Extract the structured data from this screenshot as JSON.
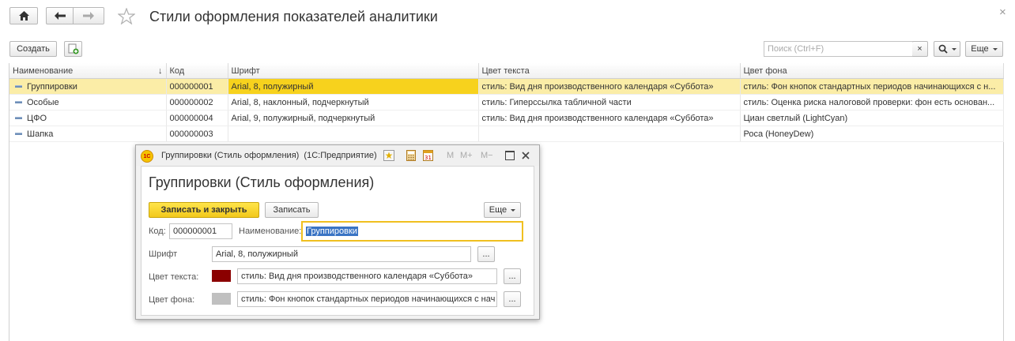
{
  "header": {
    "title": "Стили оформления показателей аналитики",
    "home_icon": "home-icon",
    "back_icon": "arrow-left-icon",
    "forward_icon": "arrow-right-icon",
    "star_icon": "star-icon",
    "close": "×"
  },
  "toolbar": {
    "create_label": "Создать",
    "search_placeholder": "Поиск (Ctrl+F)",
    "search_clear": "×",
    "more_label": "Еще"
  },
  "table": {
    "columns": [
      "Наименование",
      "Код",
      "Шрифт",
      "Цвет текста",
      "Цвет фона"
    ],
    "sort_indicator": "↓",
    "rows": [
      {
        "name": "Группировки",
        "code": "000000001",
        "font": "Arial, 8, полужирный",
        "text_color": "стиль: Вид дня производственного календаря «Суббота»",
        "bg_color": "стиль: Фон кнопок стандартных периодов начинающихся с н..."
      },
      {
        "name": "Особые",
        "code": "000000002",
        "font": "Arial, 8, наклонный, подчеркнутый",
        "text_color": "стиль: Гиперссылка табличной части",
        "bg_color": "стиль: Оценка риска налоговой проверки: фон есть основан..."
      },
      {
        "name": "ЦФО",
        "code": "000000004",
        "font": "Arial, 9, полужирный, подчеркнутый",
        "text_color": "стиль: Вид дня производственного календаря «Суббота»",
        "bg_color": "Циан светлый (LightCyan)"
      },
      {
        "name": "Шапка",
        "code": "000000003",
        "font": "",
        "text_color": "",
        "bg_color": "Роса (HoneyDew)"
      }
    ]
  },
  "dialog": {
    "window_title": "Группировки (Стиль оформления)  (1С:Предприятие)",
    "logo_text": "1С",
    "tb_m": "M",
    "tb_mplus": "M+",
    "tb_mminus": "M−",
    "heading": "Группировки (Стиль оформления)",
    "save_close_label": "Записать и закрыть",
    "save_label": "Записать",
    "more_label": "Еще",
    "code_label": "Код:",
    "code_value": "000000001",
    "name_label": "Наименование:",
    "name_value": "Группировки",
    "font_label": "Шрифт",
    "font_value": "Arial, 8, полужирный",
    "text_color_label": "Цвет текста:",
    "text_color_value": "стиль: Вид дня производственного календаря «Суббота»",
    "text_color_swatch": "#8b0000",
    "bg_color_label": "Цвет фона:",
    "bg_color_value": "стиль: Фон кнопок стандартных периодов начинающихся с нач",
    "bg_color_swatch": "#c0c0c0",
    "dots_label": "..."
  }
}
